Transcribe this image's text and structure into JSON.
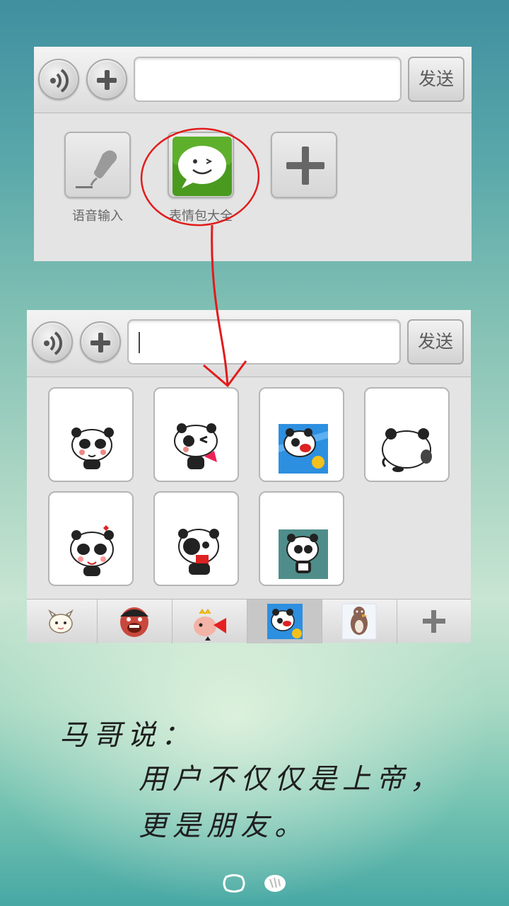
{
  "top_panel": {
    "send_label": "发送",
    "input_value": "",
    "apps": [
      {
        "label": "语音输入",
        "icon": "microphone-icon"
      },
      {
        "label": "表情包大全",
        "icon": "speech-bubble-smiley-icon"
      },
      {
        "label": "",
        "icon": "plus-icon"
      }
    ]
  },
  "bottom_panel": {
    "send_label": "发送",
    "input_value": "",
    "stickers": [
      {
        "icon": "panda-blushing-sticker"
      },
      {
        "icon": "panda-winking-sticker"
      },
      {
        "icon": "panda-blue-background-sticker"
      },
      {
        "icon": "panda-back-view-sticker"
      },
      {
        "icon": "panda-heart-sticker"
      },
      {
        "icon": "panda-eyepatch-sticker"
      },
      {
        "icon": "panda-teal-background-sticker"
      }
    ],
    "tabs": [
      {
        "icon": "cat-emoji-pack-icon",
        "active": false
      },
      {
        "icon": "angry-man-emoji-pack-icon",
        "active": false
      },
      {
        "icon": "megaphone-bird-emoji-pack-icon",
        "active": false
      },
      {
        "icon": "panda-emoji-pack-icon",
        "active": true
      },
      {
        "icon": "penguin-emoji-pack-icon",
        "active": false
      },
      {
        "icon": "add-pack-plus-icon",
        "active": false
      }
    ]
  },
  "caption": {
    "title": "马哥说：",
    "line1": "用户不仅仅是上帝，",
    "line2": "更是朋友。"
  },
  "colors": {
    "annotation_red": "#e21b1b",
    "app_green": "#4a9a1f"
  }
}
